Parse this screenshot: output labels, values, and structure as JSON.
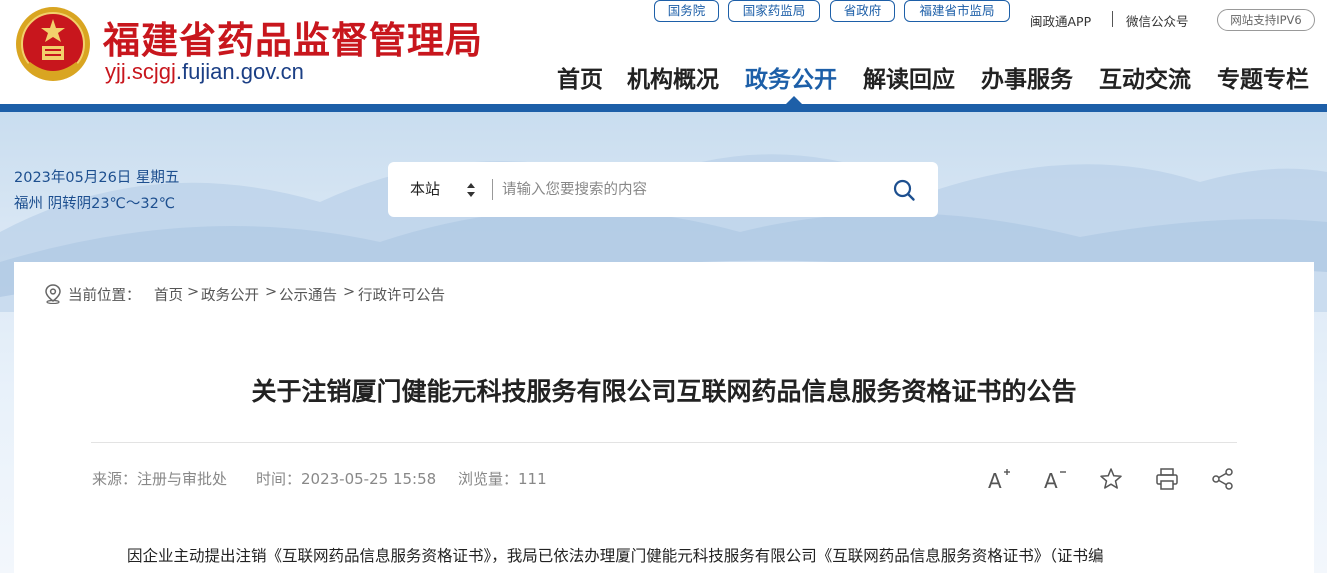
{
  "header": {
    "site_name": "福建省药品监督管理局",
    "url_highlight": "yjj.scjgj",
    "url_rest": ".fujian.gov.cn",
    "emblem_label": "药品监督"
  },
  "top_links": {
    "buttons": [
      "国务院",
      "国家药监局",
      "省政府",
      "福建省市监局"
    ],
    "app": "闽政通APP",
    "wechat": "微信公众号",
    "ipv6": "网站支持IPV6"
  },
  "nav": {
    "items": [
      "首页",
      "机构概况",
      "政务公开",
      "解读回应",
      "办事服务",
      "互动交流",
      "专题专栏"
    ],
    "active": "政务公开"
  },
  "banner": {
    "date": "2023年05月26日 星期五",
    "weather": "福州 阴转阴23℃～32℃"
  },
  "search": {
    "scope": "本站",
    "placeholder": "请输入您要搜索的内容"
  },
  "breadcrumb": {
    "label": "当前位置：",
    "items": [
      "首页",
      "政务公开",
      "公示通告",
      "行政许可公告"
    ]
  },
  "article": {
    "title": "关于注销厦门健能元科技服务有限公司互联网药品信息服务资格证书的公告",
    "source": "来源：注册与审批处",
    "time": "时间：2023-05-25 15:58",
    "views": "浏览量：111",
    "body": "因企业主动提出注销《互联网药品信息服务资格证书》，我局已依法办理厦门健能元科技服务有限公司《互联网药品信息服务资格证书》（证书编"
  },
  "tools": {
    "font_increase": "A",
    "font_decrease": "A"
  },
  "colors": {
    "brand_red": "#c8161d",
    "brand_blue": "#1d5fa8"
  }
}
